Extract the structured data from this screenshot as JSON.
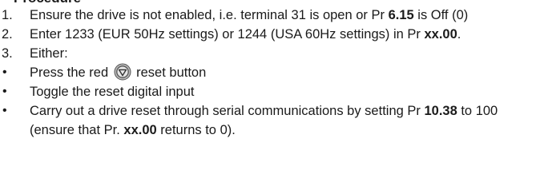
{
  "heading": "Procedure",
  "steps": [
    {
      "marker": "1.",
      "parts": [
        {
          "t": "Ensure the drive is not enabled, i.e. terminal 31 is open or Pr "
        },
        {
          "t": "6.15",
          "b": true
        },
        {
          "t": " is Off (0)"
        }
      ]
    },
    {
      "marker": "2.",
      "parts": [
        {
          "t": "Enter 1233 (EUR 50Hz settings) or 1244 (USA 60Hz settings) in Pr "
        },
        {
          "t": "xx.00",
          "b": true
        },
        {
          "t": "."
        }
      ]
    },
    {
      "marker": "3.",
      "parts": [
        {
          "t": "Either:"
        }
      ]
    }
  ],
  "options": [
    {
      "marker": "•",
      "parts": [
        {
          "t": "Press the red"
        },
        {
          "icon": "stop-reset-icon"
        },
        {
          "t": "reset button"
        }
      ]
    },
    {
      "marker": "•",
      "parts": [
        {
          "t": "Toggle the reset digital input"
        }
      ]
    },
    {
      "marker": "•",
      "parts": [
        {
          "t": "Carry out a drive reset through serial communications by setting Pr "
        },
        {
          "t": "10.38",
          "b": true
        },
        {
          "t": " to 100 (ensure that Pr. "
        },
        {
          "t": "xx.00",
          "b": true
        },
        {
          "t": " returns to 0)."
        }
      ]
    }
  ]
}
